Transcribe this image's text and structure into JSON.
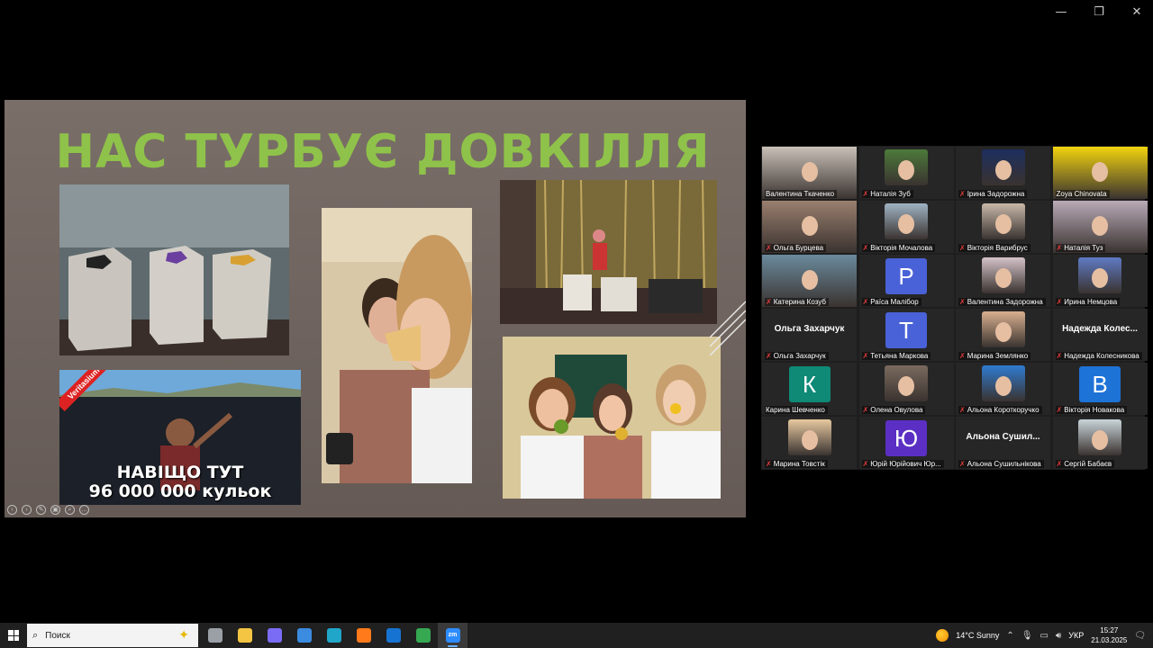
{
  "window": {
    "minimize": "—",
    "restore": "❐",
    "close": "✕"
  },
  "slide": {
    "title": "НАС ТУРБУЄ ДОВКІЛЛЯ",
    "video_caption_line1": "НАВІЩО ТУТ",
    "video_caption_line2": "96 000 000 кульок",
    "video_badge": "Veritasium",
    "nav_controls": [
      "‹",
      "›",
      "✎",
      "▣",
      "⌕",
      "…"
    ]
  },
  "gallery": {
    "participants": [
      {
        "name": "Валентина Ткаченко",
        "type": "video",
        "muted": false,
        "tone": "#c9c1b8"
      },
      {
        "name": "Наталія Зуб",
        "type": "photo",
        "muted": true,
        "tone": "#4d7a3a"
      },
      {
        "name": "Ірина Задорожна",
        "type": "photo",
        "muted": true,
        "tone": "#1d2e5e"
      },
      {
        "name": "Zoya Chinovata",
        "type": "video",
        "muted": false,
        "tone": "#f2d40e",
        "active": true
      },
      {
        "name": "Ольга Бурцева",
        "type": "video",
        "muted": true,
        "tone": "#9a7f6e"
      },
      {
        "name": "Вікторія Мочалова",
        "type": "photo",
        "muted": true,
        "tone": "#9fb3c4"
      },
      {
        "name": "Вікторія Варибрус",
        "type": "photo",
        "muted": true,
        "tone": "#c8b8a8"
      },
      {
        "name": "Наталія Туз",
        "type": "video",
        "muted": true,
        "tone": "#b9aab7"
      },
      {
        "name": "Катерина Козуб",
        "type": "video",
        "muted": true,
        "tone": "#6a8a9c"
      },
      {
        "name": "Раїса Малібор",
        "type": "letter",
        "letter": "Р",
        "muted": true,
        "tone": "#4a62d8"
      },
      {
        "name": "Валентина Задорожна",
        "type": "photo",
        "muted": true,
        "tone": "#d4c2c8"
      },
      {
        "name": "Ирина Немцова",
        "type": "photo",
        "muted": true,
        "tone": "#5f7ac4"
      },
      {
        "name": "Ольга Захарчук",
        "type": "name",
        "big": "Ольга Захарчук",
        "muted": true
      },
      {
        "name": "Тетьяна Маркова",
        "type": "letter",
        "letter": "Т",
        "muted": true,
        "tone": "#4a62d8"
      },
      {
        "name": "Марина Землянко",
        "type": "photo",
        "muted": true,
        "tone": "#d9b08f"
      },
      {
        "name": "Надежда Колесникова",
        "type": "name",
        "big": "Надежда  Колес...",
        "muted": true
      },
      {
        "name": "Карина Шевченко",
        "type": "letter",
        "letter": "К",
        "muted": false,
        "tone": "#0e8a77"
      },
      {
        "name": "Олена Овулова",
        "type": "photo",
        "muted": true,
        "tone": "#7a6a5e"
      },
      {
        "name": "Альона Короткоручко",
        "type": "photo",
        "muted": true,
        "tone": "#2f7bd0"
      },
      {
        "name": "Вікторія Новакова",
        "type": "letter",
        "letter": "В",
        "muted": true,
        "tone": "#1e73d6"
      },
      {
        "name": "Марина Товстік",
        "type": "photo",
        "muted": true,
        "tone": "#e8c9a0"
      },
      {
        "name": "Юрій Юрійович Юр...",
        "type": "letter",
        "letter": "Ю",
        "muted": true,
        "tone": "#5b2fc4"
      },
      {
        "name": "Альона Сушильнікова",
        "type": "name",
        "big": "Альона  Сушил...",
        "muted": true
      },
      {
        "name": "Сергій Бабаєв",
        "type": "photo",
        "muted": true,
        "tone": "#c9d4da"
      }
    ]
  },
  "taskbar": {
    "search_placeholder": "Поиск",
    "weather": "14°C  Sunny",
    "lang": "УКР",
    "time": "15:27",
    "date": "21.03.2025",
    "apps": [
      {
        "name": "task-view",
        "color": "#9aa0a6"
      },
      {
        "name": "file-explorer",
        "color": "#f4c542"
      },
      {
        "name": "copilot",
        "color": "#7b6cf6"
      },
      {
        "name": "store",
        "color": "#3b8be0"
      },
      {
        "name": "edge",
        "color": "#20a6c9"
      },
      {
        "name": "firefox",
        "color": "#ff7a1a"
      },
      {
        "name": "outlook",
        "color": "#1773d2"
      },
      {
        "name": "chrome",
        "color": "#36a852"
      },
      {
        "name": "zoom",
        "color": "#2d8cff",
        "label": "zm",
        "active": true
      }
    ]
  }
}
